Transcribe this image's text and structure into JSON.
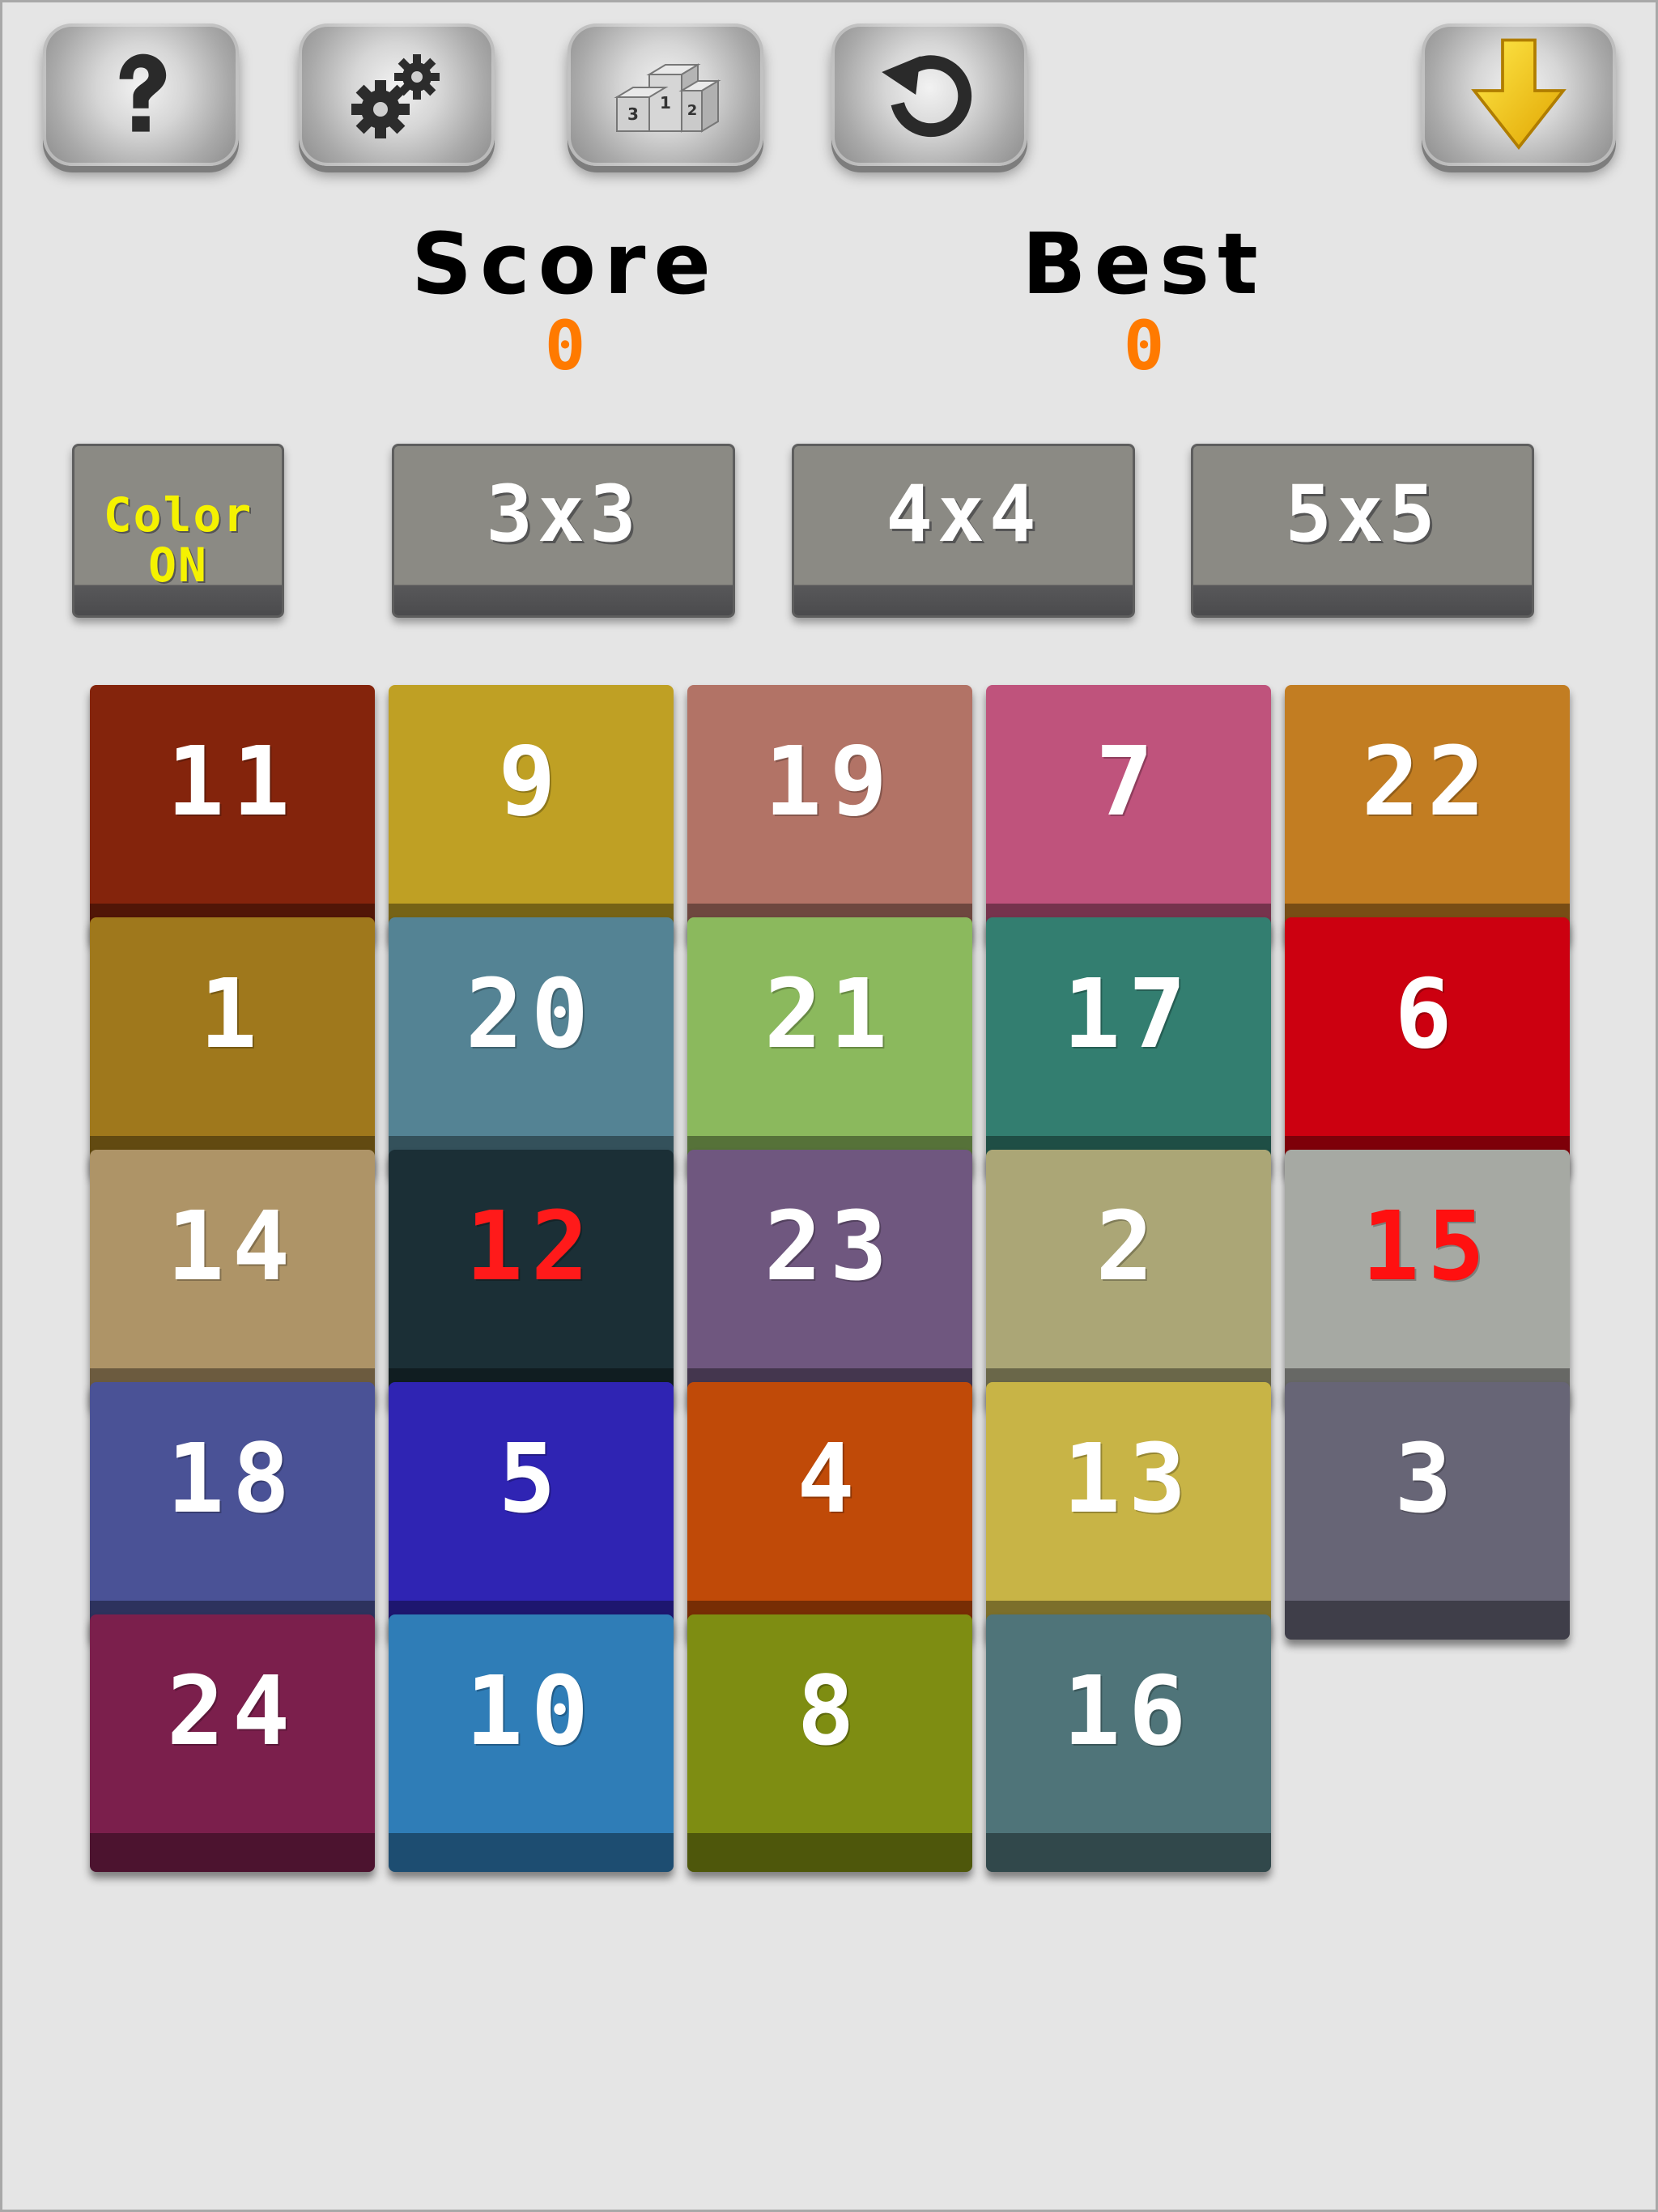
{
  "toolbar": {
    "help_icon": "question-mark-icon",
    "settings_icon": "gears-icon",
    "leaderboard_icon": "podium-icon",
    "restart_icon": "restart-arrow-icon",
    "download_icon": "down-arrow-icon"
  },
  "score": {
    "score_label": "Score",
    "score_value": "0",
    "best_label": "Best",
    "best_value": "0",
    "value_color": "#ff7a00"
  },
  "modes": {
    "color_line1": "Color",
    "color_line2": "ON",
    "size_3": "3x3",
    "size_4": "4x4",
    "size_5": "5x5"
  },
  "board": {
    "rows": [
      [
        {
          "number": "11",
          "color": "#84240c",
          "text_color": "#ffffff"
        },
        {
          "number": "9",
          "color": "#bfa024",
          "text_color": "#ffffff"
        },
        {
          "number": "19",
          "color": "#b27366",
          "text_color": "#ffffff"
        },
        {
          "number": "7",
          "color": "#bf537c",
          "text_color": "#ffffff"
        },
        {
          "number": "22",
          "color": "#c27d22",
          "text_color": "#ffffff"
        }
      ],
      [
        {
          "number": "1",
          "color": "#9f781c",
          "text_color": "#ffffff"
        },
        {
          "number": "20",
          "color": "#548394",
          "text_color": "#ffffff"
        },
        {
          "number": "21",
          "color": "#8bb95d",
          "text_color": "#ffffff"
        },
        {
          "number": "17",
          "color": "#337e70",
          "text_color": "#ffffff"
        },
        {
          "number": "6",
          "color": "#cc0010",
          "text_color": "#ffffff"
        }
      ],
      [
        {
          "number": "14",
          "color": "#ae9467",
          "text_color": "#ffffff"
        },
        {
          "number": "12",
          "color": "#1b2f36",
          "text_color": "#ff1a1a"
        },
        {
          "number": "23",
          "color": "#6f577f",
          "text_color": "#ffffff"
        },
        {
          "number": "2",
          "color": "#aba676",
          "text_color": "#ffffff"
        },
        {
          "number": "15",
          "color": "#a6a9a3",
          "text_color": "#ff1010"
        }
      ],
      [
        {
          "number": "18",
          "color": "#4a5296",
          "text_color": "#ffffff"
        },
        {
          "number": "5",
          "color": "#2f24b3",
          "text_color": "#ffffff"
        },
        {
          "number": "4",
          "color": "#c04a08",
          "text_color": "#ffffff"
        },
        {
          "number": "13",
          "color": "#c8b446",
          "text_color": "#ffffff"
        },
        {
          "number": "3",
          "color": "#676576",
          "text_color": "#ffffff"
        }
      ],
      [
        {
          "number": "24",
          "color": "#7b1f4c",
          "text_color": "#ffffff"
        },
        {
          "number": "10",
          "color": "#2f7db7",
          "text_color": "#ffffff"
        },
        {
          "number": "8",
          "color": "#7e8d12",
          "text_color": "#ffffff"
        },
        {
          "number": "16",
          "color": "#4f7479",
          "text_color": "#ffffff"
        }
      ]
    ]
  }
}
